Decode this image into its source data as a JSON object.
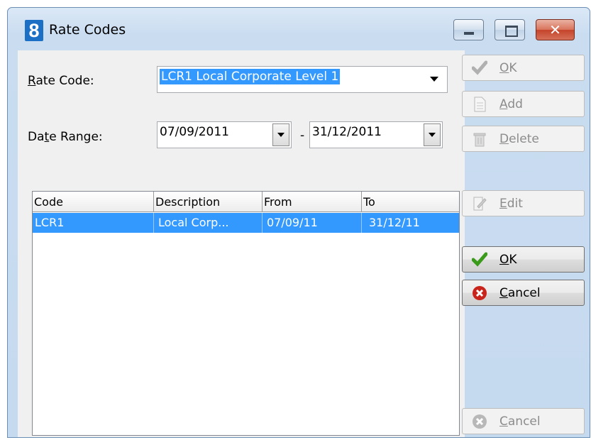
{
  "window": {
    "title": "Rate Codes",
    "icon_text": "8",
    "close_glyph": "✕"
  },
  "form": {
    "rate_code_label": "Rate Code:",
    "rate_code_value": "LCR1  Local Corporate Level 1",
    "date_range_label": "Date Range:",
    "date_from": "07/09/2011",
    "date_separator": "-",
    "date_to": "31/12/2011"
  },
  "table": {
    "columns": [
      "Code",
      "Description",
      "From",
      "To"
    ],
    "rows": [
      {
        "code": "LCR1",
        "description": "Local Corp...",
        "from": "07/09/11",
        "to": "31/12/11",
        "selected": true
      }
    ]
  },
  "buttons": {
    "ok_top": "OK",
    "add": "Add",
    "delete": "Delete",
    "edit": "Edit",
    "ok": "OK",
    "cancel": "Cancel",
    "cancel_bottom": "Cancel"
  },
  "colors": {
    "selection": "#3399ff",
    "window_frame": "#c6daef",
    "close_button": "#c4442a"
  }
}
